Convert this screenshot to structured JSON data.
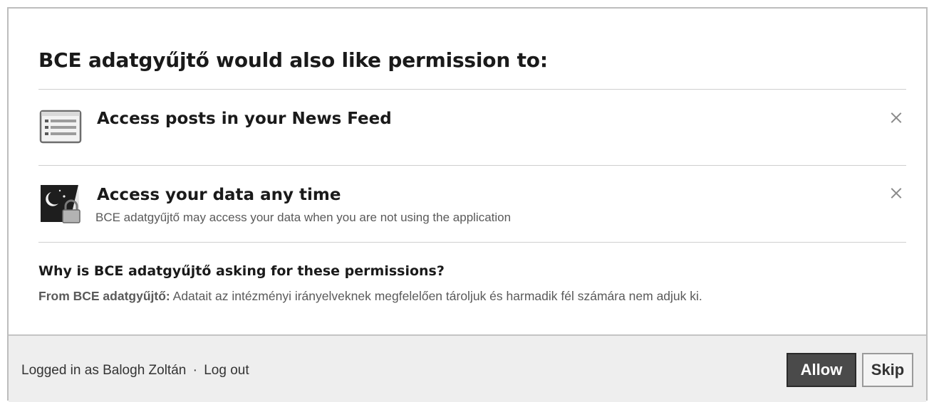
{
  "dialog": {
    "title": "BCE adatgyűjtő would also like permission to:"
  },
  "permissions": [
    {
      "icon": "news-feed-icon",
      "title": "Access posts in your News Feed",
      "description": ""
    },
    {
      "icon": "offline-access-lock-icon",
      "title": "Access your data any time",
      "description": "BCE adatgyűjtő may access your data when you are not using the application"
    }
  ],
  "why": {
    "heading": "Why is BCE adatgyűjtő asking for these permissions?",
    "from_label": "From BCE adatgyűjtő:",
    "explanation": "Adatait az intézményi irányelveknek megfelelően tároljuk és harmadik fél számára nem adjuk ki."
  },
  "footer": {
    "logged_in_text": "Logged in as Balogh Zoltán",
    "separator": "·",
    "logout_label": "Log out",
    "allow_label": "Allow",
    "skip_label": "Skip"
  }
}
